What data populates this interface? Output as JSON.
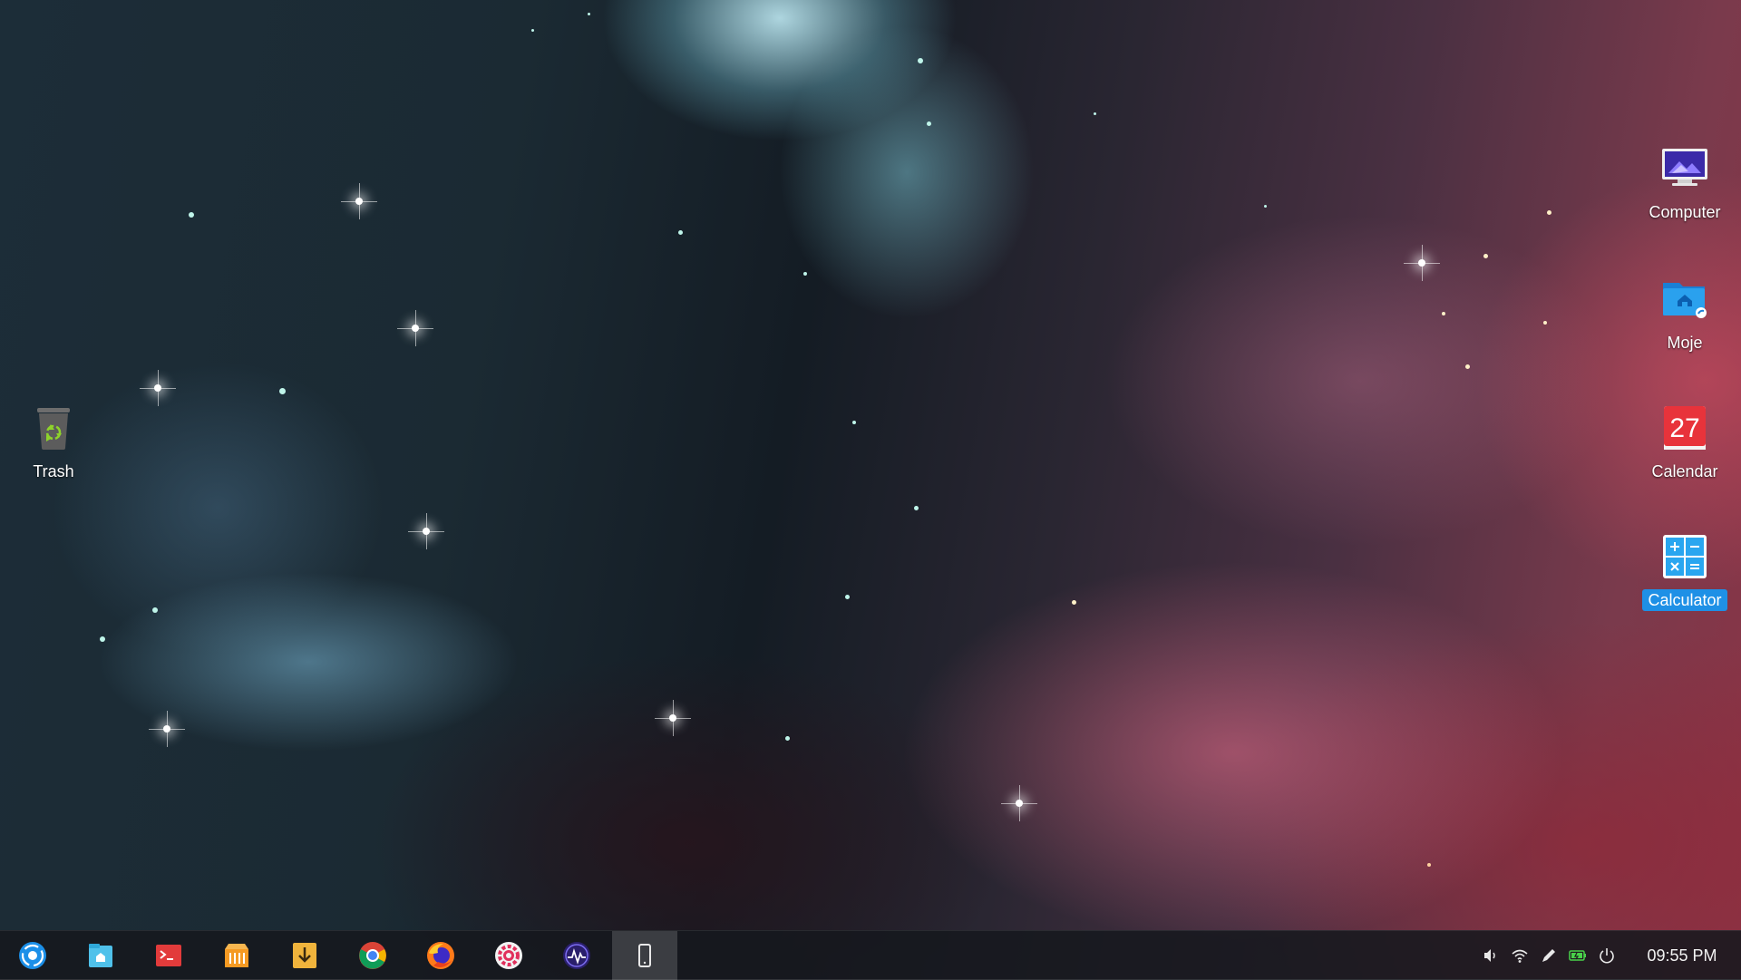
{
  "desktop": {
    "icons": [
      {
        "name": "trash-desktop-icon",
        "label": "Trash",
        "icon": "trash-icon"
      },
      {
        "name": "computer-desktop-icon",
        "label": "Computer",
        "icon": "computer-icon"
      },
      {
        "name": "moje-desktop-icon",
        "label": "Moje",
        "icon": "home-folder-icon"
      },
      {
        "name": "calendar-desktop-icon",
        "label": "Calendar",
        "icon": "calendar-icon",
        "day": "27"
      },
      {
        "name": "calculator-desktop-icon",
        "label": "Calculator",
        "icon": "calculator-icon",
        "selected": true
      }
    ],
    "selection_color": "#1e90e6"
  },
  "taskbar": {
    "apps": [
      {
        "name": "launcher",
        "icon": "launcher-icon"
      },
      {
        "name": "file-manager",
        "icon": "file-manager-icon"
      },
      {
        "name": "terminal",
        "icon": "terminal-icon"
      },
      {
        "name": "app-store",
        "icon": "app-store-icon"
      },
      {
        "name": "downloader",
        "icon": "download-icon"
      },
      {
        "name": "chrome",
        "icon": "chrome-icon"
      },
      {
        "name": "firefox",
        "icon": "firefox-icon"
      },
      {
        "name": "settings",
        "icon": "settings-icon"
      },
      {
        "name": "system-monitor",
        "icon": "system-monitor-icon"
      },
      {
        "name": "phone-assistant",
        "icon": "phone-icon",
        "active": true
      }
    ],
    "tray": [
      "volume-icon",
      "wifi-icon",
      "pen-icon",
      "battery-icon",
      "power-icon"
    ],
    "clock": "09:55 PM"
  }
}
